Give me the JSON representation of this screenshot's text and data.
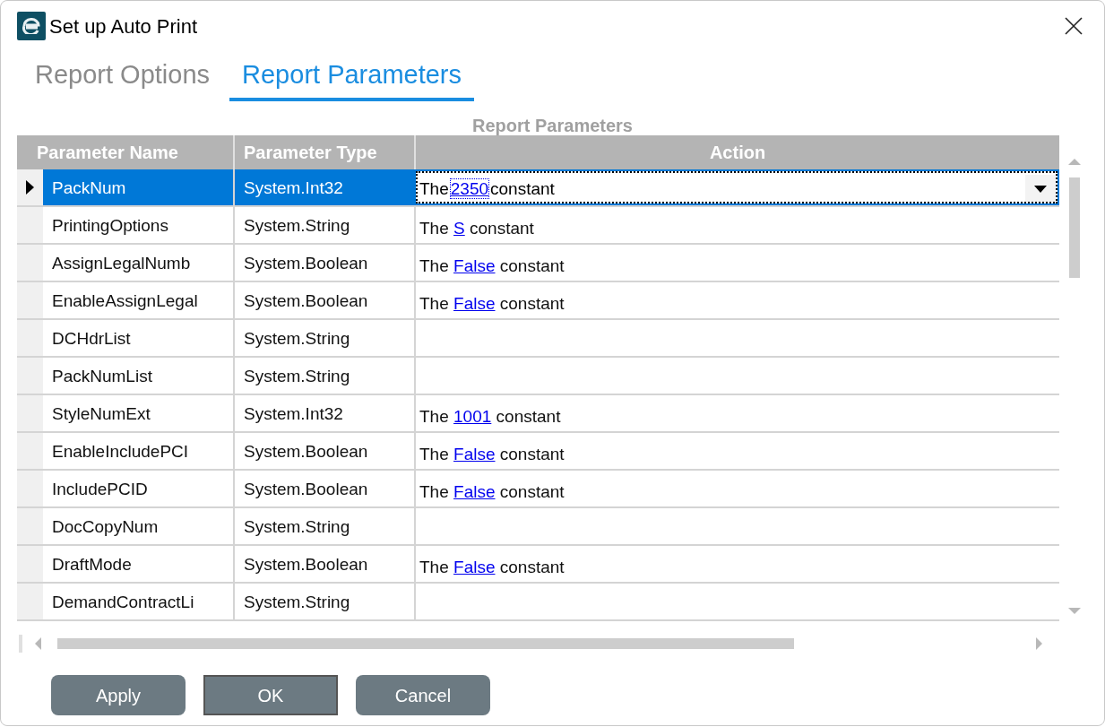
{
  "window": {
    "title": "Set up Auto Print"
  },
  "tabs": [
    {
      "label": "Report Options",
      "selected": false
    },
    {
      "label": "Report Parameters",
      "selected": true
    }
  ],
  "grid": {
    "caption": "Report Parameters",
    "columns": [
      "Parameter Name",
      "Parameter Type",
      "Action"
    ],
    "rows": [
      {
        "name": "PackNum",
        "type": "System.Int32",
        "selected": true,
        "action": {
          "prefix": "The",
          "value": "2350",
          "suffix": "constant"
        }
      },
      {
        "name": "PrintingOptions",
        "type": "System.String",
        "selected": false,
        "action": {
          "prefix": "The",
          "value": "S",
          "suffix": "constant"
        }
      },
      {
        "name": "AssignLegalNumb",
        "type": "System.Boolean",
        "selected": false,
        "action": {
          "prefix": "The",
          "value": "False",
          "suffix": "constant"
        }
      },
      {
        "name": "EnableAssignLegal",
        "type": "System.Boolean",
        "selected": false,
        "action": {
          "prefix": "The",
          "value": "False",
          "suffix": "constant"
        }
      },
      {
        "name": "DCHdrList",
        "type": "System.String",
        "selected": false
      },
      {
        "name": "PackNumList",
        "type": "System.String",
        "selected": false
      },
      {
        "name": "StyleNumExt",
        "type": "System.Int32",
        "selected": false,
        "action": {
          "prefix": "The",
          "value": "1001",
          "suffix": "constant"
        }
      },
      {
        "name": "EnableIncludePCI",
        "type": "System.Boolean",
        "selected": false,
        "action": {
          "prefix": "The",
          "value": "False",
          "suffix": "constant"
        }
      },
      {
        "name": "IncludePCID",
        "type": "System.Boolean",
        "selected": false,
        "action": {
          "prefix": "The",
          "value": "False",
          "suffix": "constant"
        }
      },
      {
        "name": "DocCopyNum",
        "type": "System.String",
        "selected": false
      },
      {
        "name": "DraftMode",
        "type": "System.Boolean",
        "selected": false,
        "action": {
          "prefix": "The",
          "value": "False",
          "suffix": "constant"
        }
      },
      {
        "name": "DemandContractLi",
        "type": "System.String",
        "selected": false
      }
    ]
  },
  "buttons": [
    {
      "label": "Apply",
      "kind": "rounded"
    },
    {
      "label": "OK",
      "kind": "default"
    },
    {
      "label": "Cancel",
      "kind": "rounded"
    }
  ]
}
